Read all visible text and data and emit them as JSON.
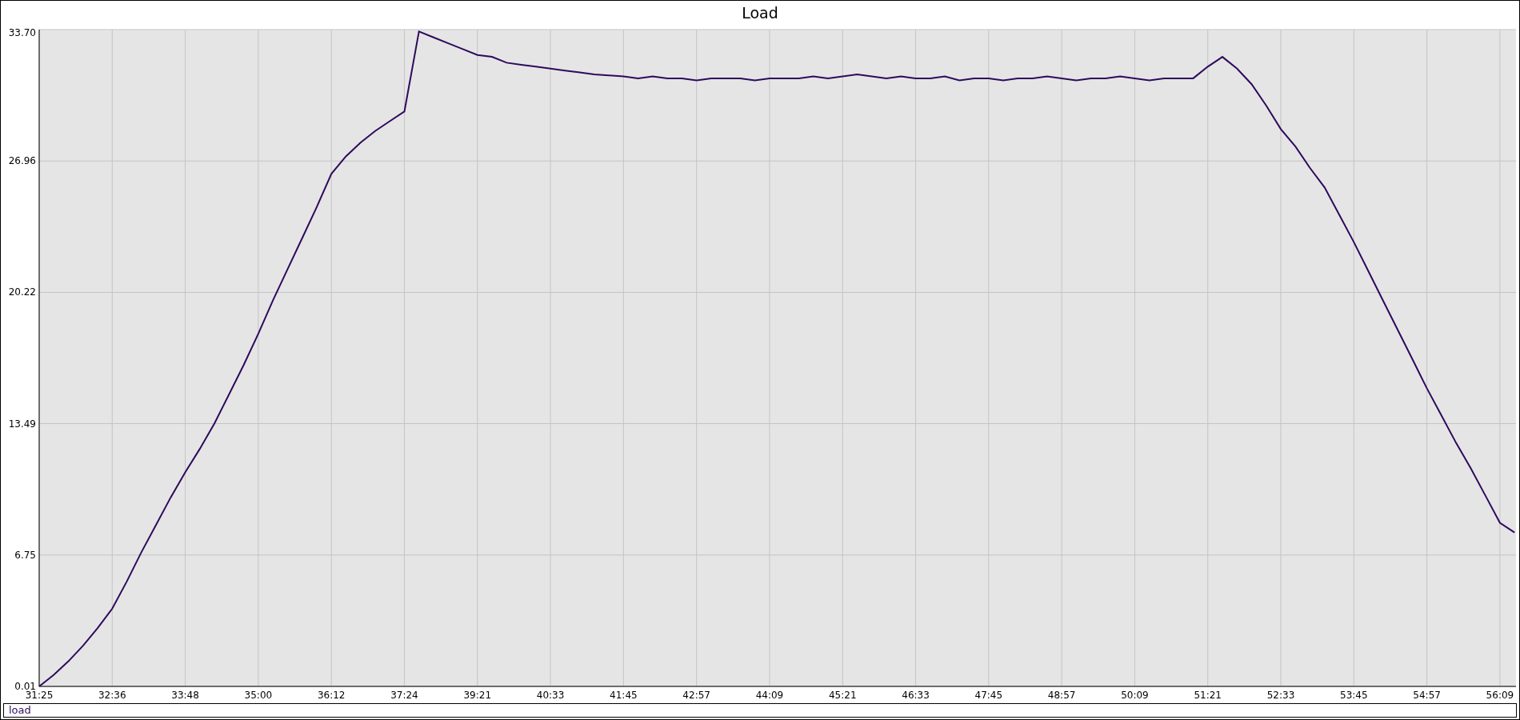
{
  "chart": {
    "chart_data": {
      "type": "line",
      "title": "Load",
      "categories": [
        "31:25",
        null,
        null,
        null,
        null,
        "32:36",
        null,
        null,
        null,
        null,
        "33:48",
        null,
        null,
        null,
        null,
        "35:00",
        null,
        null,
        null,
        null,
        "36:12",
        null,
        null,
        null,
        null,
        "37:24",
        null,
        null,
        null,
        null,
        "39:21",
        null,
        null,
        null,
        null,
        "40:33",
        null,
        null,
        null,
        null,
        "41:45",
        null,
        null,
        null,
        null,
        "42:57",
        null,
        null,
        null,
        null,
        "44:09",
        null,
        null,
        null,
        null,
        "45:21",
        null,
        null,
        null,
        null,
        "46:33",
        null,
        null,
        null,
        null,
        "47:45",
        null,
        null,
        null,
        null,
        "48:57",
        null,
        null,
        null,
        null,
        "50:09",
        null,
        null,
        null,
        null,
        "51:21",
        null,
        null,
        null,
        null,
        "52:33",
        null,
        null,
        null,
        null,
        "53:45",
        null,
        null,
        null,
        null,
        "54:57",
        null,
        null,
        null,
        null,
        "56:09",
        null
      ],
      "series": [
        {
          "name": "load",
          "color": "#2e0a5c",
          "values": [
            0.01,
            0.6,
            1.3,
            2.1,
            3.0,
            4.0,
            5.4,
            6.9,
            8.3,
            9.7,
            11.0,
            12.2,
            13.5,
            15.0,
            16.5,
            18.1,
            19.8,
            21.4,
            23.0,
            24.6,
            26.3,
            27.2,
            27.9,
            28.5,
            29.0,
            29.5,
            33.6,
            33.3,
            33.0,
            32.7,
            32.4,
            32.3,
            32.0,
            31.9,
            31.8,
            31.7,
            31.6,
            31.5,
            31.4,
            31.35,
            31.3,
            31.2,
            31.3,
            31.2,
            31.2,
            31.1,
            31.2,
            31.2,
            31.2,
            31.1,
            31.2,
            31.2,
            31.2,
            31.3,
            31.2,
            31.3,
            31.4,
            31.3,
            31.2,
            31.3,
            31.2,
            31.2,
            31.3,
            31.1,
            31.2,
            31.2,
            31.1,
            31.2,
            31.2,
            31.3,
            31.2,
            31.1,
            31.2,
            31.2,
            31.3,
            31.2,
            31.1,
            31.2,
            31.2,
            31.2,
            31.8,
            32.3,
            31.7,
            30.9,
            29.8,
            28.6,
            27.7,
            26.6,
            25.6,
            24.2,
            22.8,
            21.3,
            19.8,
            18.3,
            16.8,
            15.3,
            13.9,
            12.5,
            11.2,
            9.8,
            8.4,
            7.9
          ]
        }
      ],
      "grid": true,
      "ylim": [
        0.01,
        33.7
      ],
      "yticks": [
        {
          "value": 0.01,
          "label": "0.01"
        },
        {
          "value": 6.75,
          "label": "6.75"
        },
        {
          "value": 13.49,
          "label": "13.49"
        },
        {
          "value": 20.22,
          "label": "20.22"
        },
        {
          "value": 26.96,
          "label": "26.96"
        },
        {
          "value": 33.7,
          "label": "33.70"
        }
      ]
    }
  }
}
